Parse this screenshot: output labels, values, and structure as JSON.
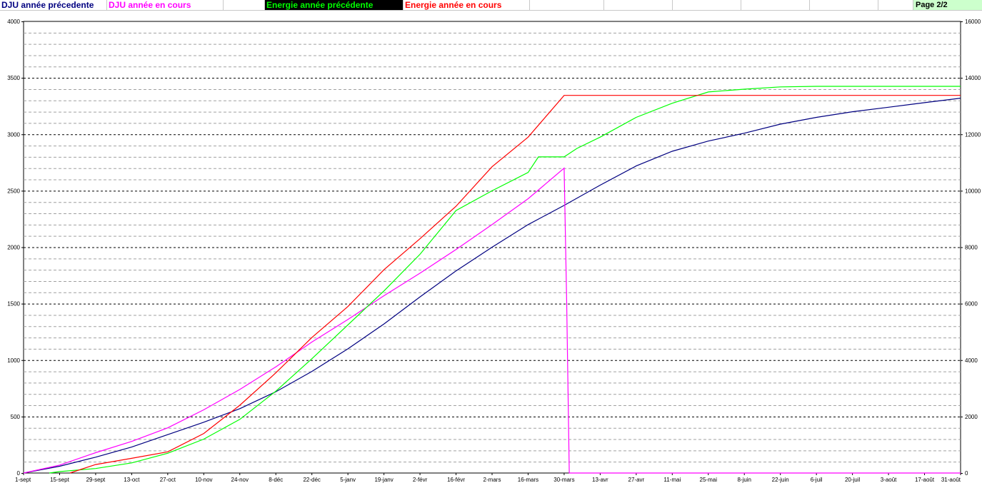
{
  "legend": {
    "items": [
      {
        "label": "DJU année précedente",
        "color": "#000080",
        "bg": "#ffffff"
      },
      {
        "label": "DJU année en cours",
        "color": "#ff00ff",
        "bg": "#ffffff"
      },
      {
        "label": "",
        "color": "#000000",
        "bg": "#ffffff"
      },
      {
        "label": "Energie année précédente",
        "color": "#00ff00",
        "bg": "#000000"
      },
      {
        "label": "Energie année en cours",
        "color": "#ff0000",
        "bg": "#ffffff"
      }
    ],
    "page_label": "Page 2/2",
    "page_bg": "#ccffcc"
  },
  "chart_data": {
    "type": "line",
    "title": "",
    "xlabel": "",
    "ylabel": "",
    "y_left_lim": [
      0,
      4000
    ],
    "y_left_ticks": [
      0,
      500,
      1000,
      1500,
      2000,
      2500,
      3000,
      3500,
      4000
    ],
    "y_right_lim": [
      0,
      16000
    ],
    "y_right_ticks": [
      0,
      2000,
      4000,
      6000,
      8000,
      10000,
      12000,
      14000,
      16000
    ],
    "x_day_range": [
      0,
      364
    ],
    "x_ticks": [
      {
        "label": "1-sept",
        "day": 0
      },
      {
        "label": "15-sept",
        "day": 14
      },
      {
        "label": "29-sept",
        "day": 28
      },
      {
        "label": "13-oct",
        "day": 42
      },
      {
        "label": "27-oct",
        "day": 56
      },
      {
        "label": "10-nov",
        "day": 70
      },
      {
        "label": "24-nov",
        "day": 84
      },
      {
        "label": "8-déc",
        "day": 98
      },
      {
        "label": "22-déc",
        "day": 112
      },
      {
        "label": "5-janv",
        "day": 126
      },
      {
        "label": "19-janv",
        "day": 140
      },
      {
        "label": "2-févr",
        "day": 154
      },
      {
        "label": "16-févr",
        "day": 168
      },
      {
        "label": "2-mars",
        "day": 182
      },
      {
        "label": "16-mars",
        "day": 196
      },
      {
        "label": "30-mars",
        "day": 210
      },
      {
        "label": "13-avr",
        "day": 224
      },
      {
        "label": "27-avr",
        "day": 238
      },
      {
        "label": "11-mai",
        "day": 252
      },
      {
        "label": "25-mai",
        "day": 266
      },
      {
        "label": "8-juin",
        "day": 280
      },
      {
        "label": "22-juin",
        "day": 294
      },
      {
        "label": "6-juil",
        "day": 308
      },
      {
        "label": "20-juil",
        "day": 322
      },
      {
        "label": "3-août",
        "day": 336
      },
      {
        "label": "17-août",
        "day": 350
      },
      {
        "label": "31-août",
        "day": 364
      }
    ],
    "grid": true,
    "series": [
      {
        "name": "DJU année précedente",
        "axis": "left",
        "color": "#000080",
        "points": [
          [
            0,
            0
          ],
          [
            14,
            60
          ],
          [
            28,
            140
          ],
          [
            42,
            230
          ],
          [
            56,
            340
          ],
          [
            70,
            450
          ],
          [
            84,
            570
          ],
          [
            98,
            720
          ],
          [
            112,
            900
          ],
          [
            126,
            1100
          ],
          [
            140,
            1320
          ],
          [
            154,
            1560
          ],
          [
            168,
            1790
          ],
          [
            182,
            2000
          ],
          [
            196,
            2200
          ],
          [
            210,
            2370
          ],
          [
            224,
            2550
          ],
          [
            238,
            2720
          ],
          [
            252,
            2850
          ],
          [
            266,
            2940
          ],
          [
            280,
            3010
          ],
          [
            294,
            3090
          ],
          [
            308,
            3150
          ],
          [
            322,
            3200
          ],
          [
            336,
            3240
          ],
          [
            350,
            3280
          ],
          [
            364,
            3320
          ]
        ]
      },
      {
        "name": "DJU année en cours",
        "axis": "left",
        "color": "#ff00ff",
        "points": [
          [
            0,
            0
          ],
          [
            14,
            70
          ],
          [
            28,
            180
          ],
          [
            42,
            280
          ],
          [
            56,
            400
          ],
          [
            70,
            560
          ],
          [
            84,
            740
          ],
          [
            98,
            940
          ],
          [
            112,
            1160
          ],
          [
            126,
            1360
          ],
          [
            140,
            1570
          ],
          [
            154,
            1770
          ],
          [
            168,
            1980
          ],
          [
            182,
            2200
          ],
          [
            196,
            2430
          ],
          [
            210,
            2700
          ],
          [
            211,
            1500
          ],
          [
            212,
            0
          ],
          [
            364,
            0
          ]
        ]
      },
      {
        "name": "Energie année précédente",
        "axis": "right",
        "color": "#00ff00",
        "points": [
          [
            10,
            0
          ],
          [
            14,
            50
          ],
          [
            28,
            160
          ],
          [
            42,
            360
          ],
          [
            56,
            700
          ],
          [
            70,
            1200
          ],
          [
            84,
            1900
          ],
          [
            98,
            2900
          ],
          [
            112,
            4050
          ],
          [
            126,
            5250
          ],
          [
            140,
            6450
          ],
          [
            154,
            7750
          ],
          [
            168,
            9300
          ],
          [
            182,
            10000
          ],
          [
            196,
            10650
          ],
          [
            200,
            11200
          ],
          [
            210,
            11200
          ],
          [
            215,
            11500
          ],
          [
            224,
            11900
          ],
          [
            238,
            12600
          ],
          [
            252,
            13100
          ],
          [
            266,
            13500
          ],
          [
            280,
            13600
          ],
          [
            294,
            13680
          ],
          [
            308,
            13700
          ],
          [
            336,
            13700
          ],
          [
            364,
            13700
          ]
        ]
      },
      {
        "name": "Energie année en cours",
        "axis": "right",
        "color": "#ff0000",
        "points": [
          [
            18,
            0
          ],
          [
            28,
            300
          ],
          [
            42,
            520
          ],
          [
            56,
            750
          ],
          [
            70,
            1400
          ],
          [
            84,
            2400
          ],
          [
            98,
            3550
          ],
          [
            112,
            4800
          ],
          [
            126,
            5900
          ],
          [
            140,
            7200
          ],
          [
            154,
            8300
          ],
          [
            168,
            9450
          ],
          [
            182,
            10850
          ],
          [
            196,
            11900
          ],
          [
            210,
            13380
          ],
          [
            364,
            13380
          ]
        ]
      }
    ]
  }
}
